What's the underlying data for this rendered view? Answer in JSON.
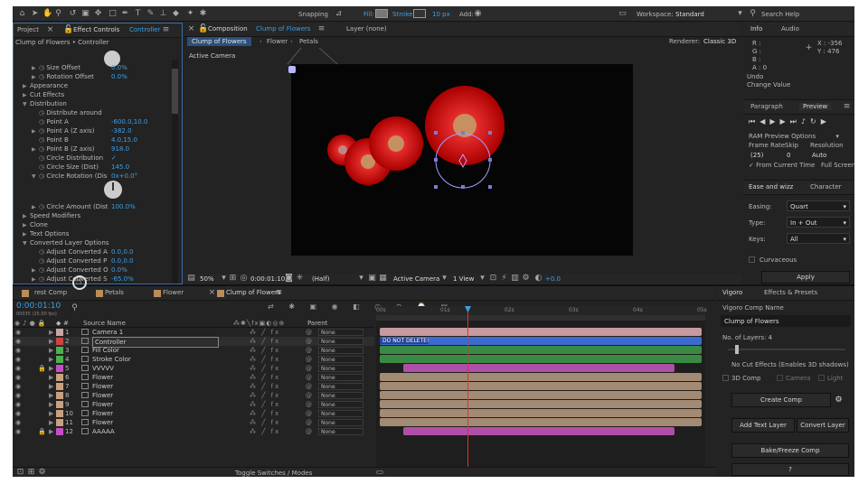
{
  "toolbar": {
    "snapping": "Snapping",
    "fill": "Fill:",
    "stroke": "Stroke:",
    "stroke_px": "10 px",
    "add": "Add:",
    "workspace_label": "Workspace:",
    "workspace_value": "Standard",
    "search": "Search Help"
  },
  "left_panel": {
    "tab_project": "Project",
    "tab_effect_controls": "Effect Controls",
    "tab_effect_target": "Controller",
    "header": "Clump of Flowers • Controller",
    "rows": [
      {
        "label": "Size Offset",
        "value": "0.0%"
      },
      {
        "label": "Rotation Offset",
        "value": "0.0%"
      },
      {
        "label": "Appearance",
        "value": ""
      },
      {
        "label": "Cut Effects",
        "value": ""
      },
      {
        "label": "Distribution",
        "value": ""
      },
      {
        "label": "Distribute around",
        "value": ""
      },
      {
        "label": "Point A",
        "value": "-600.0,10.0"
      },
      {
        "label": "Point A (Z axis)",
        "value": "-382.0"
      },
      {
        "label": "Point B",
        "value": "4.0,15.0"
      },
      {
        "label": "Point B (Z axis)",
        "value": "918.0"
      },
      {
        "label": "Circle Distribution",
        "value": "✓"
      },
      {
        "label": "Circle Size (Dist)",
        "value": "145.0"
      },
      {
        "label": "Circle Rotation (Dis",
        "value": "0x+0.0°"
      },
      {
        "label": "Circle Amount (Dist",
        "value": "100.0%"
      },
      {
        "label": "Speed Modifiers",
        "value": ""
      },
      {
        "label": "Clone",
        "value": ""
      },
      {
        "label": "Text Options",
        "value": ""
      },
      {
        "label": "Converted Layer Options",
        "value": ""
      },
      {
        "label": "Adjust Converted A",
        "value": "0.0,0.0"
      },
      {
        "label": "Adjust Converted P",
        "value": "0.0,0.0"
      },
      {
        "label": "Adjust Converted O",
        "value": "0.0%"
      },
      {
        "label": "Adjust Converted S",
        "value": "-65.0%"
      }
    ]
  },
  "comp_panel": {
    "tab_label": "Composition",
    "tab_name": "Clump of Flowers",
    "layer_tab": "Layer (none)",
    "breadcrumbs": [
      "Clump of Flowers",
      "Flower",
      "Petals"
    ],
    "renderer_label": "Renderer:",
    "renderer_value": "Classic 3D",
    "camera_label": "Active Camera",
    "zoom": "50%",
    "timecode": "0:00:01:10",
    "resolution": "(Half)",
    "view_camera": "Active Camera",
    "views": "1 View",
    "exposure": "+0.0"
  },
  "info_panel": {
    "tab_info": "Info",
    "tab_audio": "Audio",
    "r": "R :",
    "g": "G :",
    "b": "B :",
    "a": "A :",
    "a_val": "0",
    "x": "X : -356",
    "y": "Y : 476",
    "undo": "Undo",
    "change": "Change Value"
  },
  "preview_panel": {
    "tab_paragraph": "Paragraph",
    "tab_preview": "Preview",
    "ram": "RAM Preview Options",
    "frame_rate": "Frame Rate",
    "skip": "Skip",
    "resolution": "Resolution",
    "fr_val": "(25)",
    "skip_val": "0",
    "res_val": "Auto",
    "from_current": "From Current Time",
    "full_screen": "Full Screen"
  },
  "ease_panel": {
    "tab_ease": "Ease and wizz",
    "tab_character": "Character",
    "easing_label": "Easing:",
    "easing_val": "Quart",
    "type_label": "Type:",
    "type_val": "In + Out",
    "keys_label": "Keys:",
    "keys_val": "All",
    "curvaceous": "Curvaceous",
    "apply": "Apply"
  },
  "timeline": {
    "tabs": [
      "rest Comp",
      "Petals",
      "Flower",
      "Clump of Flowers"
    ],
    "timecode": "0:00:01:10",
    "frames": "00035 (25.00 fps)",
    "source_name": "Source Name",
    "parent": "Parent",
    "ruler": [
      "00s",
      "01s",
      "02s",
      "03s",
      "04s",
      "05s"
    ],
    "toggle": "Toggle Switches / Modes",
    "bar_label": "DO NOT DELETE!",
    "layers": [
      {
        "num": "1",
        "name": "Camera 1",
        "color": "#c9a6a6",
        "bar": "#c79aa0"
      },
      {
        "num": "2",
        "name": "Controller",
        "color": "#c44",
        "bar": "#3c6bd0"
      },
      {
        "num": "3",
        "name": "Fill Color",
        "color": "#4caf50",
        "bar": "#3a8a44"
      },
      {
        "num": "4",
        "name": "Stroke Color",
        "color": "#4caf50",
        "bar": "#3a8a44"
      },
      {
        "num": "5",
        "name": "VVVVV",
        "color": "#c44fc4",
        "bar": "#b04fa8"
      },
      {
        "num": "6",
        "name": "Flower",
        "color": "#c9a080",
        "bar": "#a38a73"
      },
      {
        "num": "7",
        "name": "Flower",
        "color": "#c9a080",
        "bar": "#a38a73"
      },
      {
        "num": "8",
        "name": "Flower",
        "color": "#c9a080",
        "bar": "#a38a73"
      },
      {
        "num": "9",
        "name": "Flower",
        "color": "#c9a080",
        "bar": "#a38a73"
      },
      {
        "num": "10",
        "name": "Flower",
        "color": "#c9a080",
        "bar": "#a38a73"
      },
      {
        "num": "11",
        "name": "Flower",
        "color": "#c9a080",
        "bar": "#a38a73"
      },
      {
        "num": "12",
        "name": "AAAAA",
        "color": "#c44fc4",
        "bar": "#b04fa8"
      }
    ],
    "parent_value": "None"
  },
  "vigoro": {
    "tab": "Vigoro",
    "tab2": "Effects & Presets",
    "comp_name_label": "Vigoro Comp Name",
    "comp_name": "Clump of Flowers",
    "layers": "No. of Layers: 4",
    "no_cut": "No Cut Effects (Enables 3D shadows)",
    "c3d": "3D Comp",
    "camera": "Camera",
    "light": "Light",
    "create_comp": "Create Comp",
    "add_text": "Add Text Layer",
    "convert": "Convert Layer",
    "bake": "Bake/Freeze Comp",
    "help": "?"
  }
}
